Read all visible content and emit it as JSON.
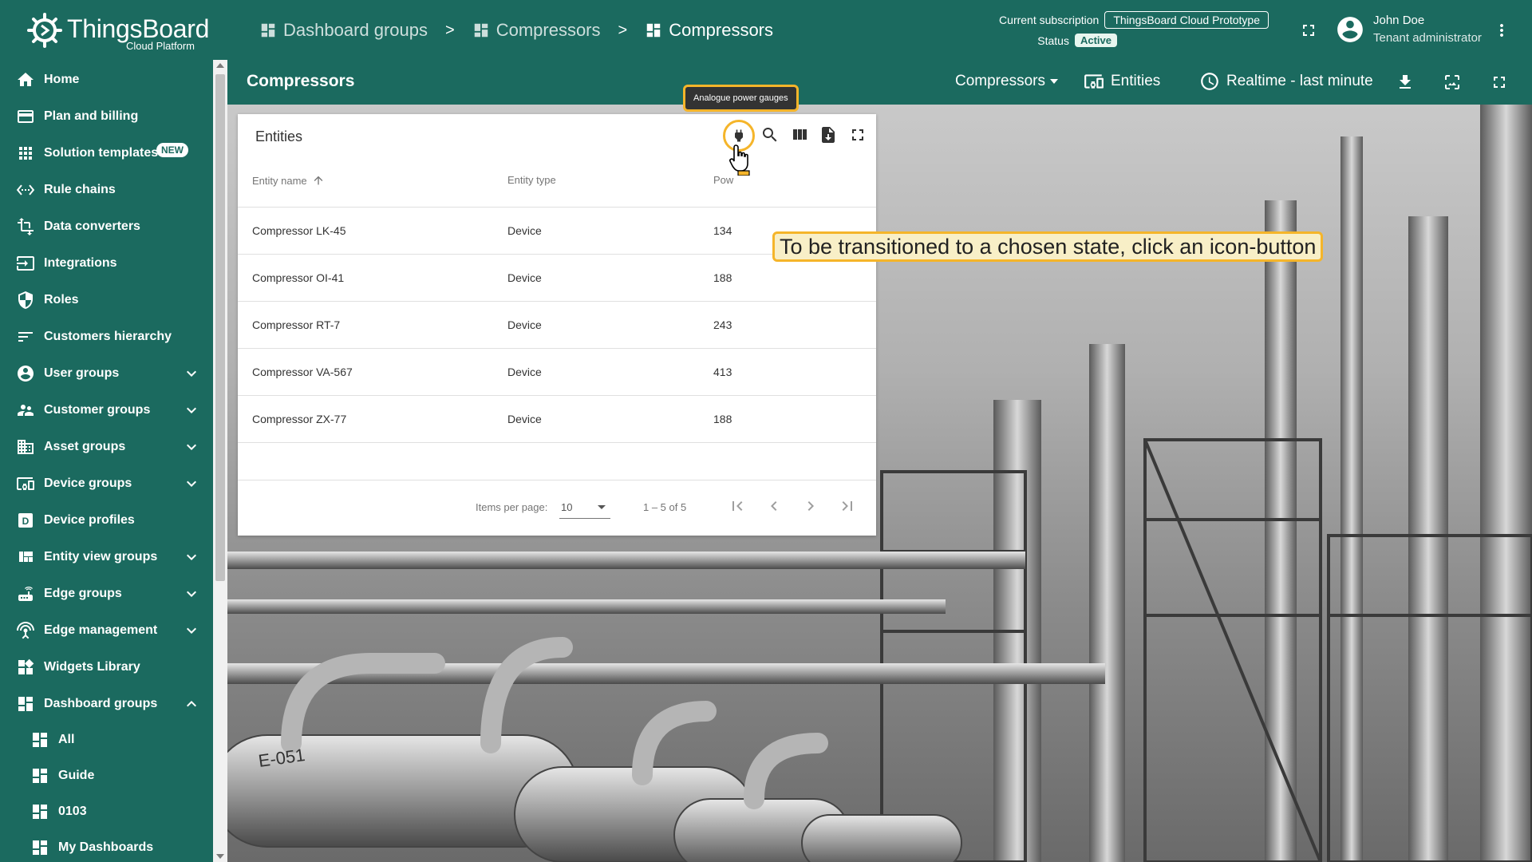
{
  "app": {
    "brand": "ThingsBoard",
    "brand_sub": "Cloud Platform"
  },
  "breadcrumbs": [
    {
      "label": "Dashboard groups"
    },
    {
      "label": "Compressors"
    },
    {
      "label": "Compressors"
    }
  ],
  "breadcrumb_separator": ">",
  "subscription": {
    "label": "Current subscription",
    "value": "ThingsBoard Cloud Prototype",
    "status_label": "Status",
    "status_value": "Active"
  },
  "user": {
    "name": "John Doe",
    "role": "Tenant administrator"
  },
  "sidebar": {
    "items": [
      {
        "label": "Home",
        "icon": "home-icon"
      },
      {
        "label": "Plan and billing",
        "icon": "credit-card-icon"
      },
      {
        "label": "Solution templates",
        "icon": "apps-grid-icon",
        "badge": "NEW"
      },
      {
        "label": "Rule chains",
        "icon": "settings-ethernet-icon"
      },
      {
        "label": "Data converters",
        "icon": "transform-icon"
      },
      {
        "label": "Integrations",
        "icon": "input-icon"
      },
      {
        "label": "Roles",
        "icon": "security-shield-icon"
      },
      {
        "label": "Customers hierarchy",
        "icon": "sort-icon"
      },
      {
        "label": "User groups",
        "icon": "account-circle-icon"
      },
      {
        "label": "Customer groups",
        "icon": "supervisor-icon"
      },
      {
        "label": "Asset groups",
        "icon": "domain-icon"
      },
      {
        "label": "Device groups",
        "icon": "devices-other-icon"
      },
      {
        "label": "Device profiles",
        "icon": "device-profile-icon"
      },
      {
        "label": "Entity view groups",
        "icon": "view-quilt-icon"
      },
      {
        "label": "Edge groups",
        "icon": "router-icon"
      },
      {
        "label": "Edge management",
        "icon": "settings-input-antenna-icon"
      },
      {
        "label": "Widgets Library",
        "icon": "widgets-icon"
      },
      {
        "label": "Dashboard groups",
        "icon": "dashboard-icon"
      },
      {
        "label": "All",
        "icon": "dashboard-icon"
      },
      {
        "label": "Guide",
        "icon": "dashboard-icon"
      },
      {
        "label": "0103",
        "icon": "dashboard-icon"
      },
      {
        "label": "My Dashboards",
        "icon": "dashboard-icon"
      }
    ]
  },
  "dashboard": {
    "title": "Compressors",
    "state_select": "Compressors",
    "entities_button": "Entities",
    "timewindow": "Realtime - last minute"
  },
  "widget": {
    "title": "Entities",
    "columns": [
      "Entity name",
      "Entity type",
      "Pow"
    ],
    "rows": [
      {
        "name": "Compressor LK-45",
        "type": "Device",
        "power": "134"
      },
      {
        "name": "Compressor OI-41",
        "type": "Device",
        "power": "188"
      },
      {
        "name": "Compressor RT-7",
        "type": "Device",
        "power": "243"
      },
      {
        "name": "Compressor VA-567",
        "type": "Device",
        "power": "413"
      },
      {
        "name": "Compressor ZX-77",
        "type": "Device",
        "power": "188"
      }
    ],
    "items_per_page_label": "Items per page:",
    "items_per_page_value": "10",
    "range_label": "1 – 5 of 5"
  },
  "tooltips": {
    "small": "Analogue power gauges",
    "big": "To be transitioned to a chosen state, click an icon-button"
  },
  "colors": {
    "primary": "#1b6a5f",
    "highlight": "#f5b52a"
  }
}
